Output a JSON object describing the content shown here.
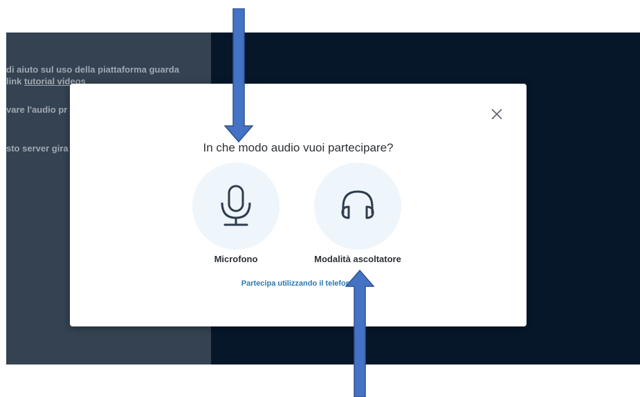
{
  "chat": {
    "line1": "di aiuto sul uso della piattaforma guarda",
    "line2_prefix": "link ",
    "line2_link": "tutorial videos",
    "line3": "vare l'audio pr",
    "line4": "sto server gira"
  },
  "modal": {
    "title": "In che modo audio vuoi partecipare?",
    "microphone_label": "Microfono",
    "listen_label": "Modalità ascoltatore",
    "phone_link": "Partecipa utilizzando il telefono"
  },
  "icons": {
    "close": "close-icon",
    "microphone": "microphone-icon",
    "headphones": "headphones-icon"
  },
  "colors": {
    "app_background": "#06172a",
    "chat_panel": "#4e5a66",
    "icon_circle": "#eef5fb",
    "link": "#2b7ab0",
    "annotation_arrow": "#4472c4"
  }
}
